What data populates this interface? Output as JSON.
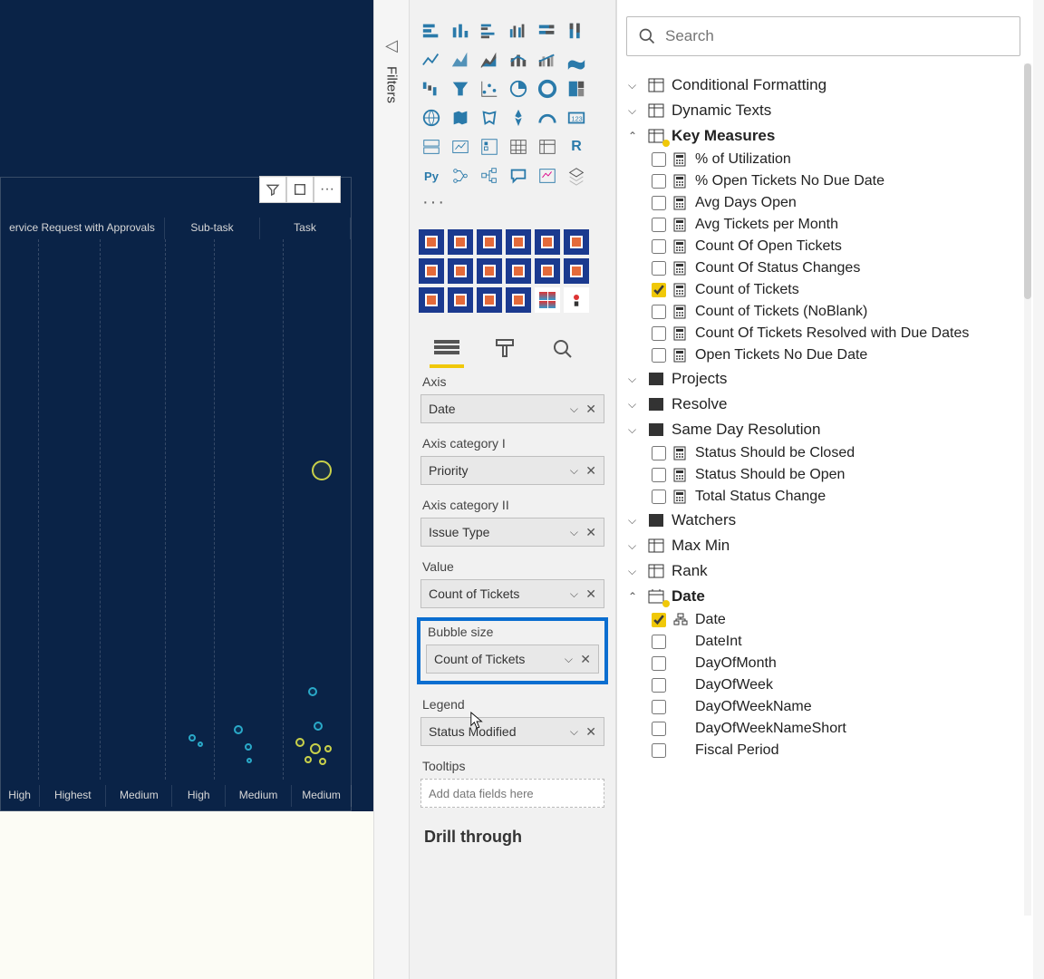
{
  "filters_label": "Filters",
  "chart": {
    "col_headers": [
      "ervice Request with Approvals",
      "Sub-task",
      "Task"
    ],
    "cat_labels": [
      "High",
      "Highest",
      "Medium",
      "High",
      "Medium",
      "Medium"
    ],
    "toolbar_items": [
      "filter",
      "focus",
      "more"
    ]
  },
  "wells": {
    "axis": {
      "label": "Axis",
      "value": "Date"
    },
    "axis_cat1": {
      "label": "Axis category I",
      "value": "Priority"
    },
    "axis_cat2": {
      "label": "Axis category II",
      "value": "Issue Type"
    },
    "value": {
      "label": "Value",
      "value": "Count of Tickets"
    },
    "bubble": {
      "label": "Bubble size",
      "value": "Count of Tickets"
    },
    "legend": {
      "label": "Legend",
      "value": "Status Modified"
    },
    "tooltips": {
      "label": "Tooltips",
      "placeholder": "Add data fields here"
    }
  },
  "drill_through": "Drill through",
  "search": {
    "placeholder": "Search"
  },
  "tree": {
    "tables_collapsed": [
      "Conditional Formatting",
      "Dynamic Texts"
    ],
    "key_measures": {
      "name": "Key Measures",
      "items": [
        {
          "name": "% of Utilization",
          "checked": false
        },
        {
          "name": "% Open Tickets No Due Date",
          "checked": false
        },
        {
          "name": "Avg Days Open",
          "checked": false
        },
        {
          "name": "Avg Tickets per Month",
          "checked": false
        },
        {
          "name": "Count Of Open Tickets",
          "checked": false
        },
        {
          "name": "Count Of Status Changes",
          "checked": false
        },
        {
          "name": "Count of Tickets",
          "checked": true
        },
        {
          "name": "Count of Tickets (NoBlank)",
          "checked": false
        },
        {
          "name": "Count Of Tickets Resolved with Due Dates",
          "checked": false
        },
        {
          "name": "Open Tickets No Due Date",
          "checked": false
        }
      ]
    },
    "more_collapsed": [
      "Projects",
      "Resolve",
      "Same Day Resolution"
    ],
    "same_day_children": [
      {
        "name": "Status Should be Closed",
        "checked": false
      },
      {
        "name": "Status Should be Open",
        "checked": false
      },
      {
        "name": "Total Status Change",
        "checked": false
      }
    ],
    "watchers": "Watchers",
    "max_min": "Max Min",
    "rank": "Rank",
    "date_table": {
      "name": "Date",
      "items": [
        {
          "name": "Date",
          "checked": true,
          "hier": true
        },
        {
          "name": "DateInt",
          "checked": false
        },
        {
          "name": "DayOfMonth",
          "checked": false
        },
        {
          "name": "DayOfWeek",
          "checked": false
        },
        {
          "name": "DayOfWeekName",
          "checked": false
        },
        {
          "name": "DayOfWeekNameShort",
          "checked": false
        },
        {
          "name": "Fiscal Period",
          "checked": false
        }
      ]
    }
  },
  "colors": {
    "accent": "#f0c808",
    "highlight": "#0b6ed0"
  }
}
